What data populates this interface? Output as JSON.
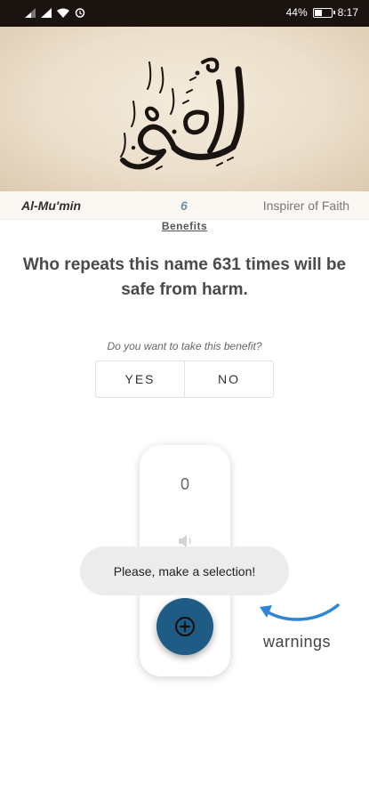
{
  "status_bar": {
    "battery": "44%",
    "time": "8:17",
    "battery_level": 0.44,
    "icons": [
      "signal-icon",
      "signal-icon",
      "wifi-icon",
      "alarm-icon",
      "battery-icon"
    ]
  },
  "header": {
    "image": "arabic-calligraphy-al-mumin",
    "calligraphy_text": "المؤمن"
  },
  "name": {
    "transliteration": "Al-Mu'min",
    "number": "6",
    "meaning": "Inspirer of Faith"
  },
  "benefits": {
    "link_label": "Benefits",
    "text": "Who repeats this name 631 times will be safe from harm."
  },
  "prompt": {
    "question": "Do you want to take this benefit?",
    "yes_label": "YES",
    "no_label": "NO"
  },
  "counter": {
    "value": "0",
    "sound_icon": "speaker-icon",
    "add_icon": "plus-circle-icon"
  },
  "toast": {
    "message": "Please, make a selection!"
  },
  "annotation": {
    "label": "warnings",
    "arrow_color": "#2f86d6"
  },
  "colors": {
    "accent": "#1e5c86",
    "number_accent": "#6f8ea8",
    "status_bar": "#1b130f"
  }
}
